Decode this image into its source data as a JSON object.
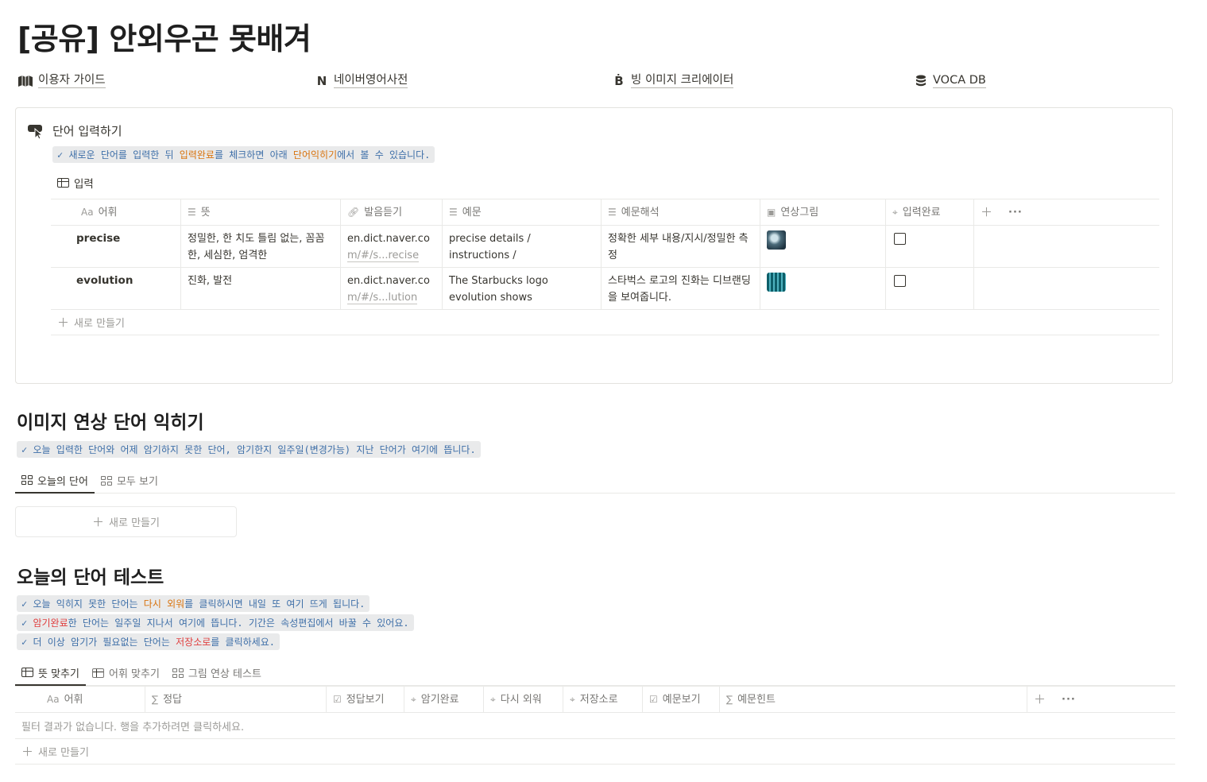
{
  "page": {
    "title": "[공유] 안외우곤 못배겨"
  },
  "links": [
    {
      "icon": "book-map-icon",
      "label": "이용자 가이드"
    },
    {
      "icon": "N",
      "label": "네이버영어사전"
    },
    {
      "icon": "Ḃ",
      "label": "빙 이미지 크리에이터"
    },
    {
      "icon": "database-icon",
      "label": "VOCA DB"
    }
  ],
  "input_section": {
    "heading": "단어 입력하기",
    "tip": {
      "check": "✓",
      "p1": "새로운 단어를 입력한 뒤 ",
      "h1": "입력완료",
      "p2": "를 체크하면 아래 ",
      "h2": "단어익히기",
      "p3": "에서 볼 수 있습니다."
    },
    "db_title": "입력",
    "columns": [
      "어휘",
      "뜻",
      "발음듣기",
      "예문",
      "예문해석",
      "연상그림",
      "입력완료"
    ],
    "col_prefix": "Aa",
    "rows": [
      {
        "word": "precise",
        "meaning": "정밀한, 한 치도 틀림 없는, 꼼꼼한, 세심한, 엄격한",
        "url_a": "en.dict.naver.co",
        "url_b1": "m/",
        "url_b2": "#/s...recise",
        "example": "precise details / instructions / measurements",
        "translation": "정확한 세부 내용/지시/정밀한 측정"
      },
      {
        "word": "evolution",
        "meaning": "진화, 발전",
        "url_a": "en.dict.naver.co",
        "url_b1": "m/",
        "url_b2": "#/s...lution",
        "example": "The Starbucks logo evolution shows debranding.",
        "translation": "스타벅스 로고의 진화는 디브랜딩을 보여줍니다."
      }
    ],
    "new_label": "새로 만들기",
    "more": "···"
  },
  "gallery_section": {
    "title": "이미지 연상 단어 익히기",
    "tip": {
      "check": "✓",
      "text": "오늘 입력한 단어와 어제 암기하지 못한 단어, 암기한지 일주일(변경가능) 지난 단어가 여기에 뜹니다."
    },
    "tabs": [
      "오늘의 단어",
      "모두 보기"
    ],
    "new_label": "새로 만들기"
  },
  "test_section": {
    "title": "오늘의 단어 테스트",
    "tips": [
      {
        "check": "✓",
        "p1": "오늘 익히지 못한 단어는 ",
        "h": "다시 외워",
        "p2": "를 클릭하시면 내일 또 여기 뜨게 됩니다."
      },
      {
        "check": "✓",
        "h": "암기완료",
        "p2": "한 단어는 일주일 지나서 여기에 뜹니다. 기간은 속성편집에서 바꿀 수 있어요."
      },
      {
        "check": "✓",
        "p1": "더 이상 암기가 필요없는 단어는 ",
        "h": "저장소로",
        "p2": "를 클릭하세요."
      }
    ],
    "tabs": [
      "뜻 맞추기",
      "어휘 맞추기",
      "그림 연상 테스트"
    ],
    "columns": [
      "어휘",
      "정답",
      "정답보기",
      "암기완료",
      "다시 외워",
      "저장소로",
      "예문보기",
      "예문힌트"
    ],
    "col_prefix": "Aa",
    "empty_text": "필터 결과가 없습니다. 행을 추가하려면 클릭하세요.",
    "new_label": "새로 만들기",
    "more": "···"
  },
  "colors": {
    "tip_text": "#3e6fa8",
    "tip_bg": "#e9eaeb",
    "orange": "#d9730d",
    "red": "#e03e3e"
  }
}
